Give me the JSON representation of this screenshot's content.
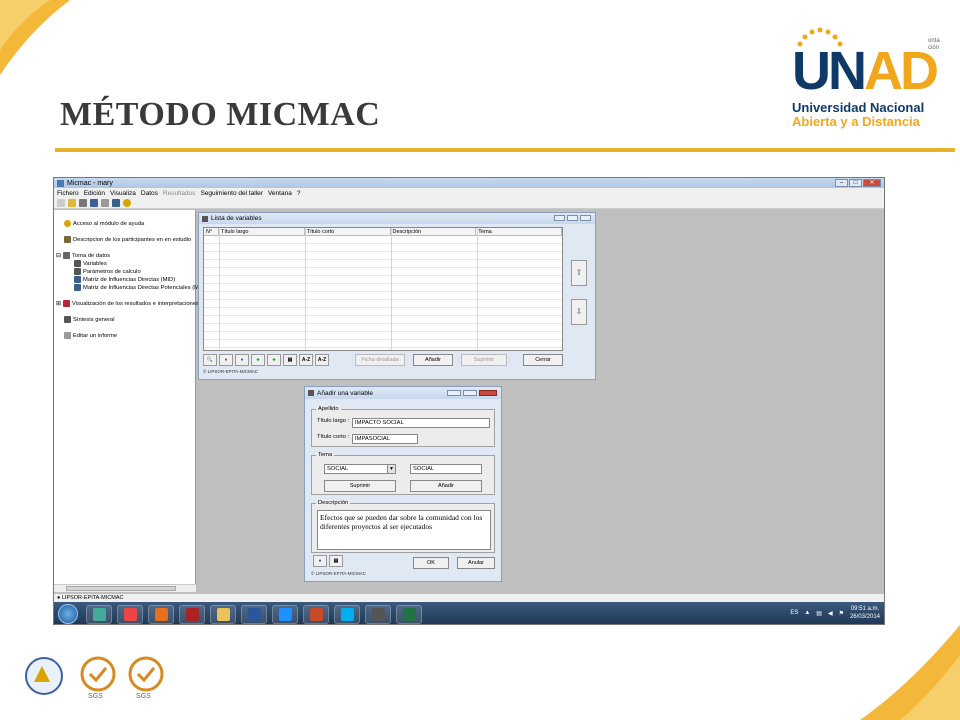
{
  "slide": {
    "title": "MÉTODO MICMAC",
    "logo_letters_blue": "UN",
    "logo_letters_gold": "AD",
    "logo_line1": "Universidad Nacional",
    "logo_line2": "Abierta y a Distancia",
    "logo_side_text": "onta\nción"
  },
  "colors": {
    "accent": "#e8b12c",
    "brand_blue": "#0f3a67",
    "brand_gold": "#f0a71c"
  },
  "app": {
    "window_title": "Micmac - mary",
    "menu": [
      "Fichero",
      "Edición",
      "Visualiza",
      "Datos",
      "Resultados",
      "Seguimiento del taller",
      "Ventana",
      "?"
    ],
    "menu_disabled": [
      "Resultados"
    ],
    "statusbar": "LIPSOR-EPITA-MICMAC"
  },
  "tree": [
    {
      "label": "Acceso al módulo de ayuda",
      "icon": "help-icon",
      "color": "#d9a400"
    },
    {
      "label": "Descripcion de los participantes en en estudio",
      "icon": "people-icon",
      "color": "#7a6a3a"
    },
    {
      "label": "Toma de datos",
      "icon": "data-icon",
      "color": "#666"
    },
    {
      "label": "Variables",
      "icon": "variables-icon",
      "color": "#444"
    },
    {
      "label": "Parámetros de calculo",
      "icon": "params-icon",
      "color": "#444"
    },
    {
      "label": "Matriz de Influencias Directas (MID)",
      "icon": "matrix-icon",
      "color": "#3a5f88"
    },
    {
      "label": "Matriz de Influencias Directas Potenciales (M",
      "icon": "matrix-icon",
      "color": "#3a5f88"
    },
    {
      "label": "Visualización de los resultados e interpretaciones",
      "icon": "chart-icon",
      "color": "#b23"
    },
    {
      "label": "Síntesis general",
      "icon": "synthesis-icon",
      "color": "#444"
    },
    {
      "label": "Editar un informe",
      "icon": "report-icon",
      "color": "#888"
    }
  ],
  "lista_variables": {
    "title": "Lista de variables",
    "columns": [
      "N°",
      "Título largo",
      "Título corto",
      "Descripción",
      "Tema"
    ],
    "tool_labels": [
      "A-Z",
      "A-Z"
    ],
    "buttons": {
      "ficha": "Ficha detallada",
      "anadir": "Añadir",
      "suprimir": "Suprimir",
      "cerrar": "Cerrar"
    },
    "copyright": "© LIPSOR-EPITA-MICMAC"
  },
  "anadir_variable": {
    "title": "Añadir una variable",
    "apellido_legend": "Apellido",
    "titulo_largo_label": "Título largo :",
    "titulo_largo_value": "IMPACTO SOCIAL",
    "titulo_corto_label": "Título corto :",
    "titulo_corto_value": "IMPASOCIAL",
    "tema_legend": "Tema",
    "tema_select": "SOCIAL",
    "tema_text": "SOCIAL",
    "suprimir": "Suprimir",
    "anadir": "Añadir",
    "descripcion_legend": "Descripción",
    "descripcion_text": "Efectos que se pueden dar sobre la comunidad con los diferentes proyectos al ser ejecutados",
    "ok": "OK",
    "anular": "Anular",
    "copyright": "© LIPSOR-EPITA-MICMAC"
  },
  "taskbar": {
    "apps": [
      "media-player-icon",
      "chrome-icon",
      "firefox-icon",
      "video-icon",
      "folder-icon",
      "word-icon",
      "ie-icon",
      "powerpoint-icon",
      "skype-icon",
      "calculator-icon",
      "excel-icon"
    ],
    "app_colors": [
      "#4a9",
      "#e44",
      "#e8701a",
      "#a22",
      "#e8c35a",
      "#2b579a",
      "#1e90ff",
      "#c94a2a",
      "#00aff0",
      "#555",
      "#217346"
    ],
    "lang": "ES",
    "time": "09:51 a.m.",
    "date": "26/03/2014"
  }
}
